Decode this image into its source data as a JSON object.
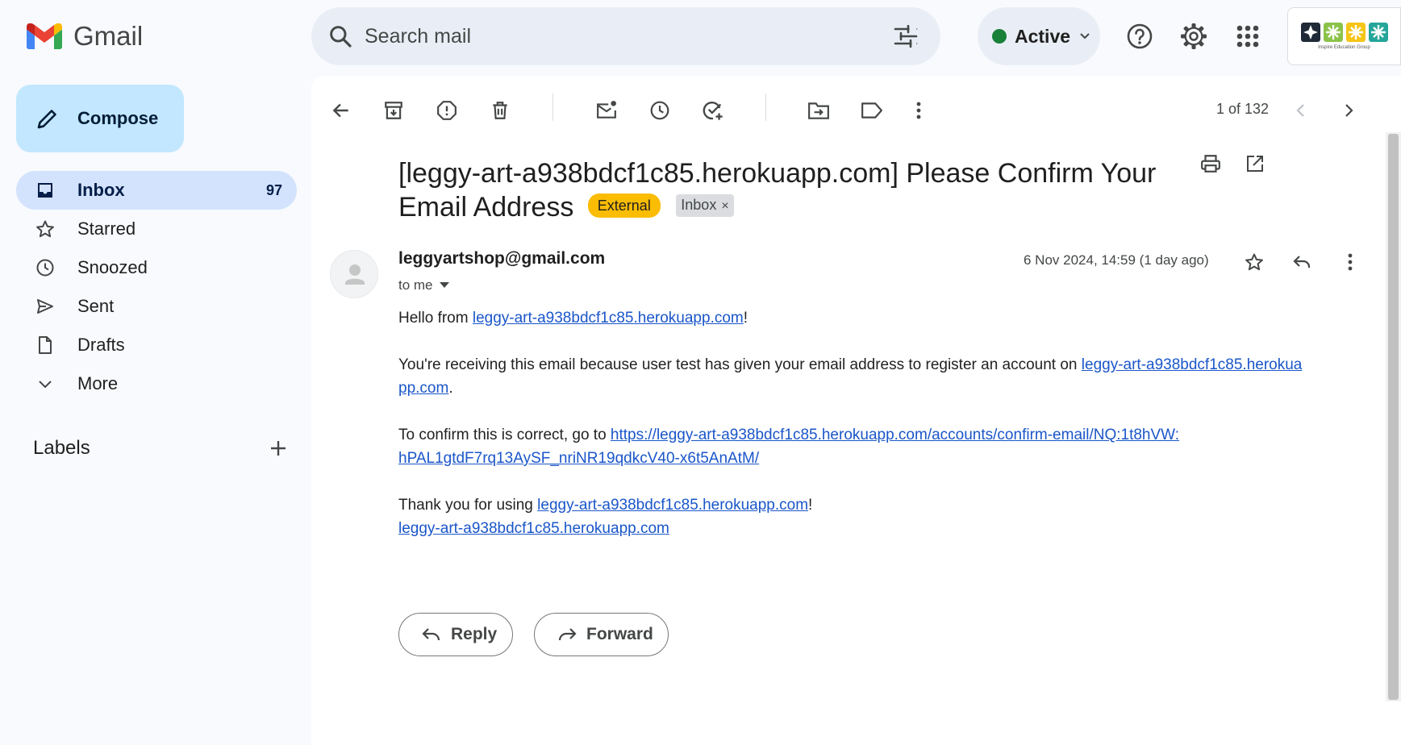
{
  "app": {
    "name": "Gmail"
  },
  "search": {
    "placeholder": "Search mail"
  },
  "status": {
    "label": "Active",
    "color": "#188038"
  },
  "colors": {
    "compose_bg": "#c2e7ff",
    "selected_bg": "#d3e3fd",
    "external_badge": "#fbbc04",
    "link": "#1a56c9"
  },
  "sidebar": {
    "compose_label": "Compose",
    "items": [
      {
        "label": "Inbox",
        "count": "97",
        "icon": "inbox-icon"
      },
      {
        "label": "Starred",
        "icon": "star-icon"
      },
      {
        "label": "Snoozed",
        "icon": "clock-icon"
      },
      {
        "label": "Sent",
        "icon": "send-icon"
      },
      {
        "label": "Drafts",
        "icon": "draft-icon"
      },
      {
        "label": "More",
        "icon": "chevron-down-icon"
      }
    ],
    "labels_title": "Labels"
  },
  "toolbar": {
    "pager": "1 of 132"
  },
  "email": {
    "subject": "[leggy-art-a938bdcf1c85.herokuapp.com] Please Confirm Your Email Address",
    "badge_external": "External",
    "badge_inbox": "Inbox",
    "badge_remove": "×",
    "sender": "leggyartshop@gmail.com",
    "to": "to me",
    "date": "6 Nov 2024, 14:59 (1 day ago)",
    "body": {
      "p1_prefix": "Hello from ",
      "p1_link": "leggy-art-a938bdcf1c85.herokuapp.com",
      "p1_suffix": "!",
      "p2_prefix": "You're receiving this email because user test has given your email address to register an account on ",
      "p2_link_line1": "leggy-art-a938bdcf1c85.herokua",
      "p2_link_line2": "pp.com",
      "p2_suffix": ".",
      "p3_prefix": "To confirm this is correct, go to ",
      "p3_link_line1": "https://leggy-art-a938bdcf1c85.herokuapp.com/accounts/confirm-email/NQ:1t8hVW:",
      "p3_link_line2": "hPAL1gtdF7rq13AySF_nriNR19qdkcV40-x6t5AnAtM/",
      "p4_prefix": "Thank you for using ",
      "p4_link": "leggy-art-a938bdcf1c85.herokuapp.com",
      "p4_suffix": "!",
      "p4_link2": "leggy-art-a938bdcf1c85.herokuapp.com"
    }
  },
  "actions": {
    "reply_label": "Reply",
    "forward_label": "Forward"
  },
  "org_logo": {
    "caption": "Inspire Education Group"
  }
}
